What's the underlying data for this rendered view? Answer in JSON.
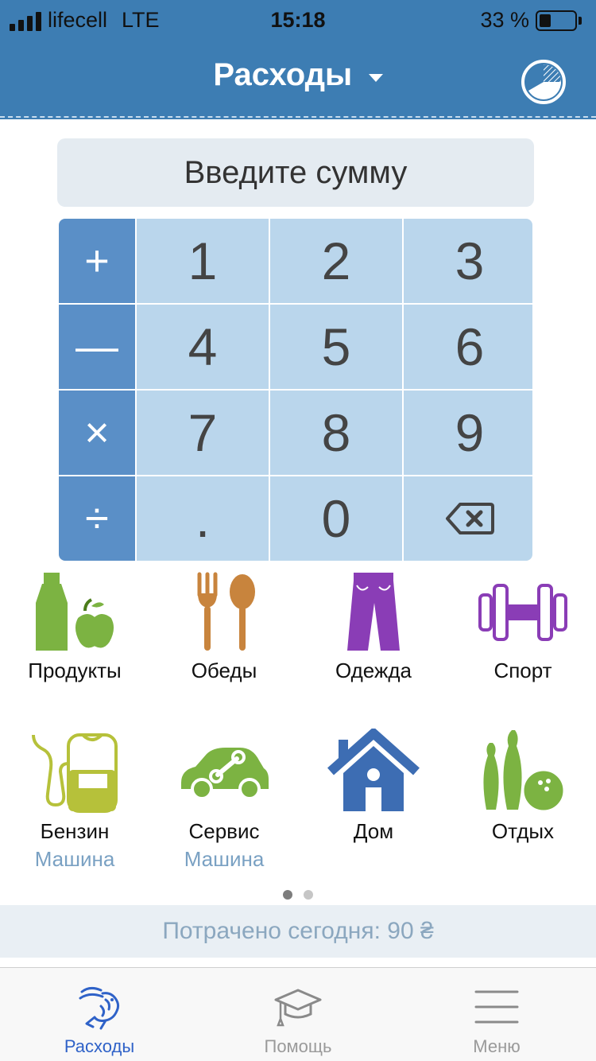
{
  "status_bar": {
    "carrier": "lifecell",
    "network": "LTE",
    "time": "15:18",
    "battery": "33 %"
  },
  "header": {
    "title": "Расходы",
    "stats_icon": "pie-chart-icon"
  },
  "amount_input": {
    "placeholder": "Введите сумму"
  },
  "keypad": {
    "operators": [
      "+",
      "—",
      "×",
      "÷"
    ],
    "digits": [
      "1",
      "2",
      "3",
      "4",
      "5",
      "6",
      "7",
      "8",
      "9",
      ".",
      "0"
    ],
    "backspace_icon": "backspace-icon"
  },
  "categories": [
    {
      "label": "Продукты",
      "sub": "",
      "icon": "groceries-icon"
    },
    {
      "label": "Обеды",
      "sub": "",
      "icon": "fork-spoon-icon"
    },
    {
      "label": "Одежда",
      "sub": "",
      "icon": "pants-icon"
    },
    {
      "label": "Спорт",
      "sub": "",
      "icon": "dumbbell-icon"
    },
    {
      "label": "Бензин",
      "sub": "Машина",
      "icon": "fuel-pump-icon"
    },
    {
      "label": "Сервис",
      "sub": "Машина",
      "icon": "car-service-icon"
    },
    {
      "label": "Дом",
      "sub": "",
      "icon": "house-icon"
    },
    {
      "label": "Отдых",
      "sub": "",
      "icon": "bowling-icon"
    }
  ],
  "pager": {
    "pages": 2,
    "current": 1
  },
  "spent_today": "Потрачено сегодня: 90 ₴",
  "tabs": [
    {
      "label": "Расходы",
      "icon": "rabbit-icon",
      "active": true
    },
    {
      "label": "Помощь",
      "icon": "graduation-cap-icon",
      "active": false
    },
    {
      "label": "Меню",
      "icon": "hamburger-icon",
      "active": false
    }
  ],
  "colors": {
    "header": "#3d7db3",
    "key": "#bad6ec",
    "operator_key": "#5a8fc7",
    "active_tab": "#2f62c8",
    "subcategory": "#7aa1c3"
  }
}
